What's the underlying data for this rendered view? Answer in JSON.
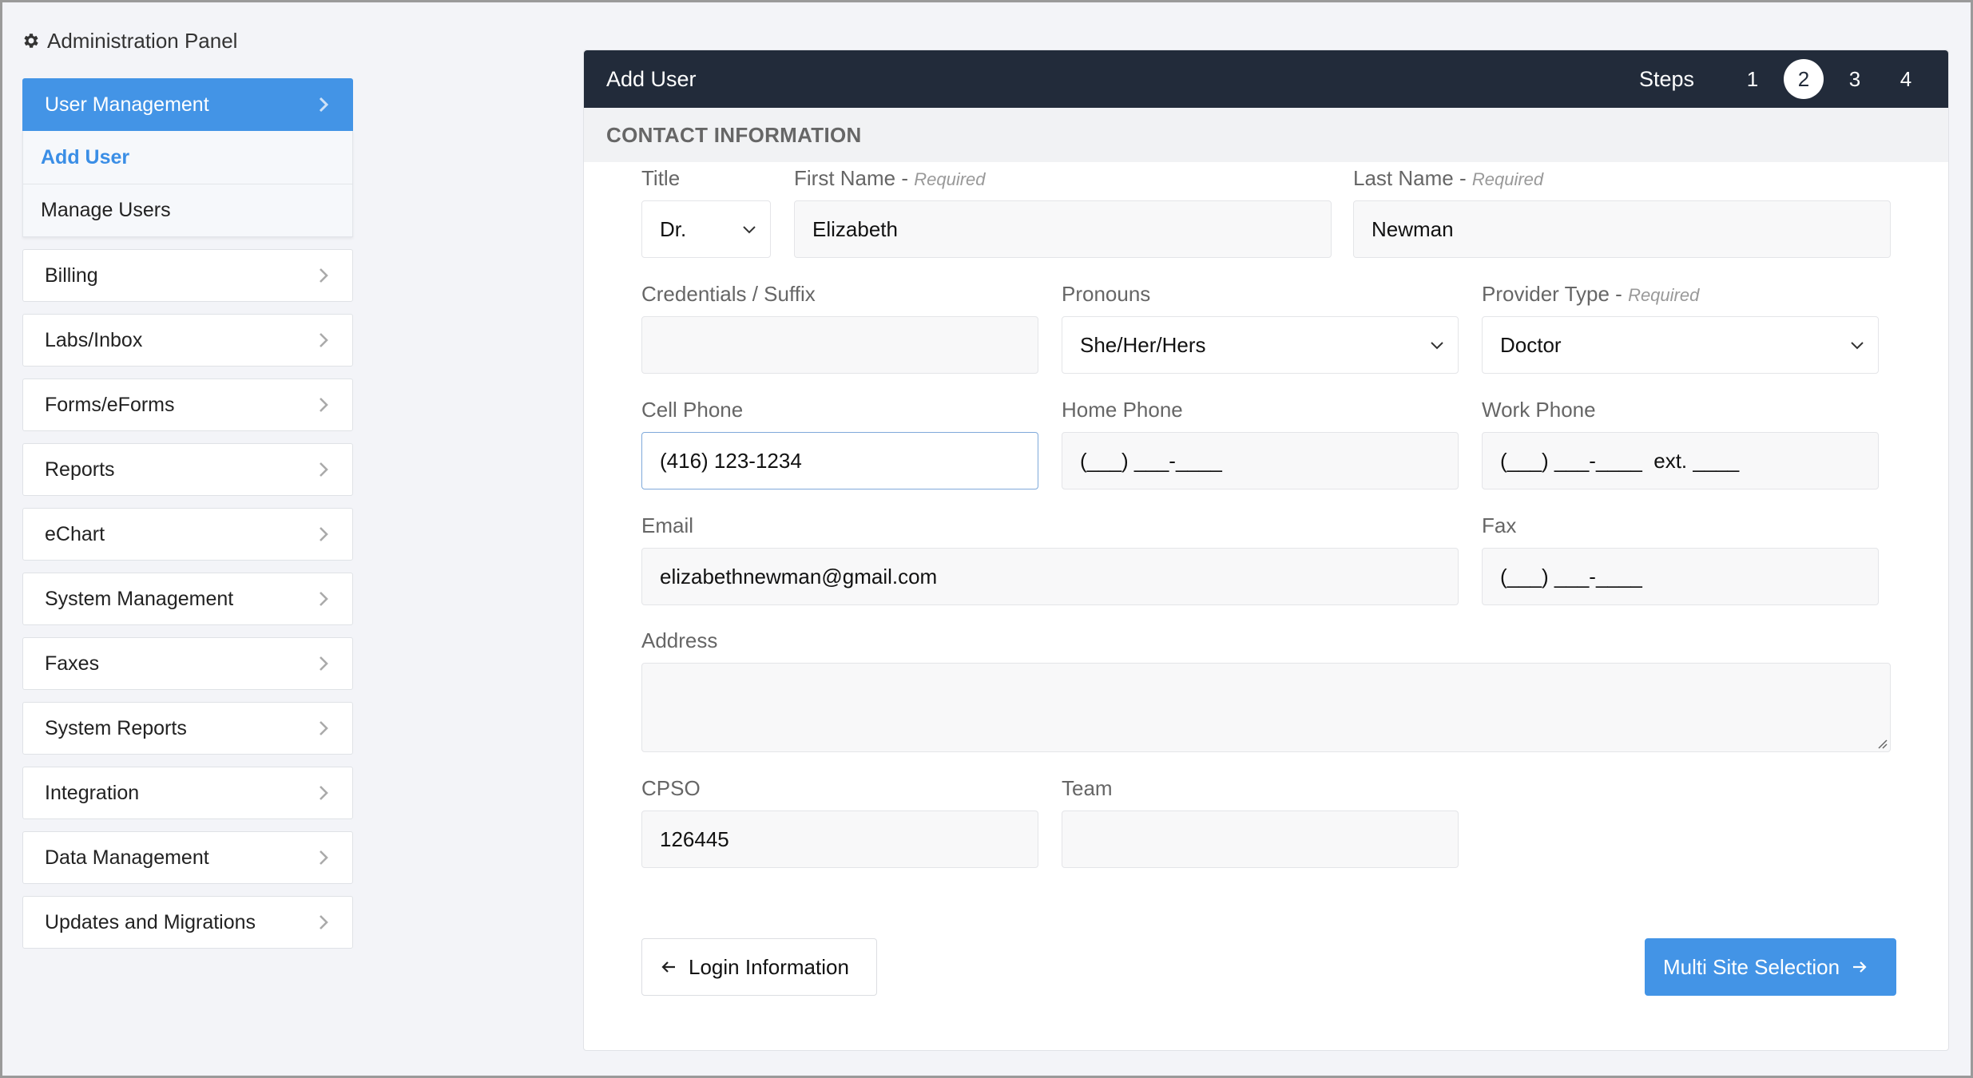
{
  "panel": {
    "title": "Administration Panel"
  },
  "sidebar": {
    "active": {
      "label": "User Management"
    },
    "subitems": [
      {
        "label": "Add User"
      },
      {
        "label": "Manage Users"
      }
    ],
    "items": [
      {
        "label": "Billing"
      },
      {
        "label": "Labs/Inbox"
      },
      {
        "label": "Forms/eForms"
      },
      {
        "label": "Reports"
      },
      {
        "label": "eChart"
      },
      {
        "label": "System Management"
      },
      {
        "label": "Faxes"
      },
      {
        "label": "System Reports"
      },
      {
        "label": "Integration"
      },
      {
        "label": "Data Management"
      },
      {
        "label": "Updates and Migrations"
      }
    ]
  },
  "card": {
    "title": "Add User",
    "steps_label": "Steps",
    "steps": [
      "1",
      "2",
      "3",
      "4"
    ],
    "section": "CONTACT INFORMATION"
  },
  "form": {
    "title": {
      "label": "Title",
      "value": "Dr."
    },
    "first_name": {
      "label": "First Name -",
      "required": "Required",
      "value": "Elizabeth"
    },
    "last_name": {
      "label": "Last Name -",
      "required": "Required",
      "value": "Newman"
    },
    "credentials": {
      "label": "Credentials / Suffix",
      "value": ""
    },
    "pronouns": {
      "label": "Pronouns",
      "value": "She/Her/Hers"
    },
    "provider_type": {
      "label": "Provider Type -",
      "required": "Required",
      "value": "Doctor"
    },
    "cell_phone": {
      "label": "Cell Phone",
      "value": "(416) 123-1234"
    },
    "home_phone": {
      "label": "Home Phone",
      "value": "(___) ___-____"
    },
    "work_phone": {
      "label": "Work Phone",
      "value": "(___) ___-____  ext. ____"
    },
    "email": {
      "label": "Email",
      "value": "elizabethnewman@gmail.com"
    },
    "fax": {
      "label": "Fax",
      "value": "(___) ___-____"
    },
    "address": {
      "label": "Address",
      "value": ""
    },
    "cpso": {
      "label": "CPSO",
      "value": "126445"
    },
    "team": {
      "label": "Team",
      "value": ""
    }
  },
  "buttons": {
    "back": "Login Information",
    "next": "Multi Site Selection"
  },
  "colors": {
    "accent": "#4394e6",
    "header": "#222b3a"
  }
}
